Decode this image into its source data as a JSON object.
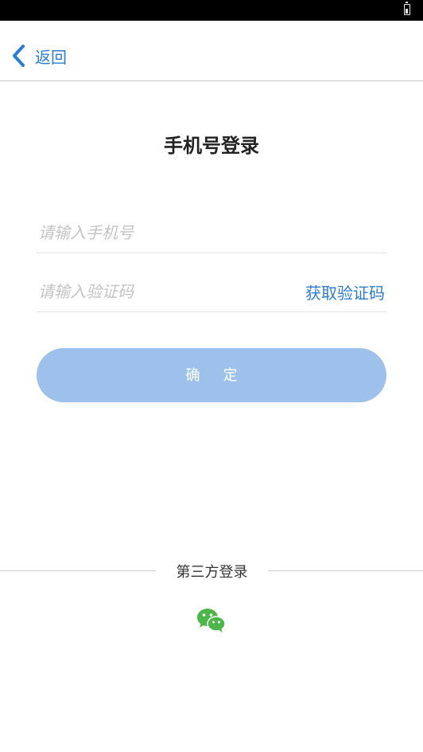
{
  "nav": {
    "back_label": "返回"
  },
  "page": {
    "title": "手机号登录"
  },
  "form": {
    "phone_placeholder": "请输入手机号",
    "phone_value": "",
    "code_placeholder": "请输入验证码",
    "code_value": "",
    "get_code_label": "获取验证码",
    "confirm_label": "确 定"
  },
  "third_party": {
    "label": "第三方登录",
    "icons": [
      "wechat-icon"
    ]
  },
  "colors": {
    "accent": "#2b7cd3",
    "button_bg": "#9dc1ea",
    "wechat": "#4cb648"
  },
  "icons": {
    "back": "chevron-left-icon",
    "battery": "battery-icon"
  }
}
